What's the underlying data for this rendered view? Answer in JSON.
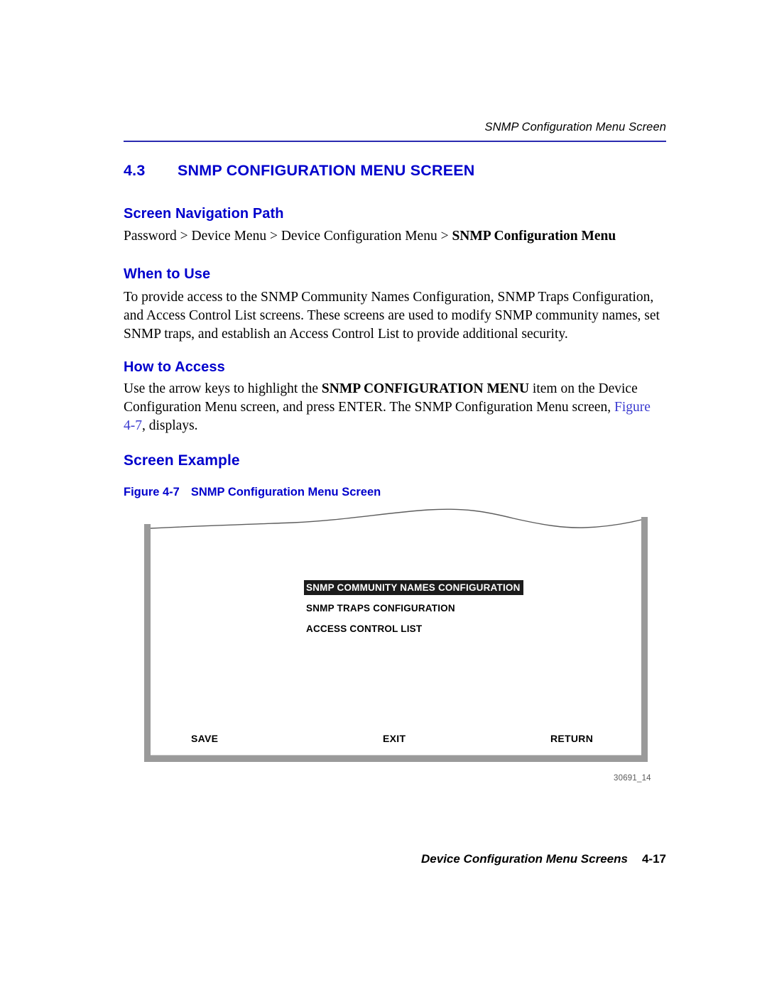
{
  "header": {
    "running_head": "SNMP Configuration Menu Screen"
  },
  "section": {
    "number": "4.3",
    "title": "SNMP CONFIGURATION MENU SCREEN"
  },
  "nav_path": {
    "heading": "Screen Navigation Path",
    "prefix": "Password > Device Menu > Device Configuration Menu > ",
    "current": "SNMP Configuration Menu"
  },
  "when_to_use": {
    "heading": "When to Use",
    "body": "To provide access to the SNMP Community Names Configuration, SNMP Traps Configuration, and Access Control List screens. These screens are used to modify SNMP community names, set SNMP traps, and establish an Access Control List to provide additional security."
  },
  "how_to_access": {
    "heading": "How to Access",
    "part1": "Use the arrow keys to highlight the ",
    "emphasis": "SNMP CONFIGURATION MENU",
    "part2": " item on the Device Configuration Menu screen, and press ENTER. The SNMP Configuration Menu screen, ",
    "xref": "Figure 4-7",
    "part3": ", displays."
  },
  "screen_example": {
    "heading": "Screen Example",
    "figure_number": "Figure 4-7",
    "figure_title": "SNMP Configuration Menu Screen",
    "figure_id": "30691_14"
  },
  "terminal": {
    "menu_items": [
      {
        "label": "SNMP COMMUNITY NAMES CONFIGURATION",
        "selected": true
      },
      {
        "label": "SNMP TRAPS CONFIGURATION",
        "selected": false
      },
      {
        "label": "ACCESS CONTROL LIST",
        "selected": false
      }
    ],
    "actions": {
      "save": "SAVE",
      "exit": "EXIT",
      "return": "RETURN"
    }
  },
  "footer": {
    "title": "Device Configuration Menu Screens",
    "page": "4-17"
  },
  "colors": {
    "heading_blue": "#0000cc",
    "rule_blue": "#2b2bb0",
    "frame_gray": "#9a9a9a",
    "highlight_black": "#1c1c1c"
  }
}
